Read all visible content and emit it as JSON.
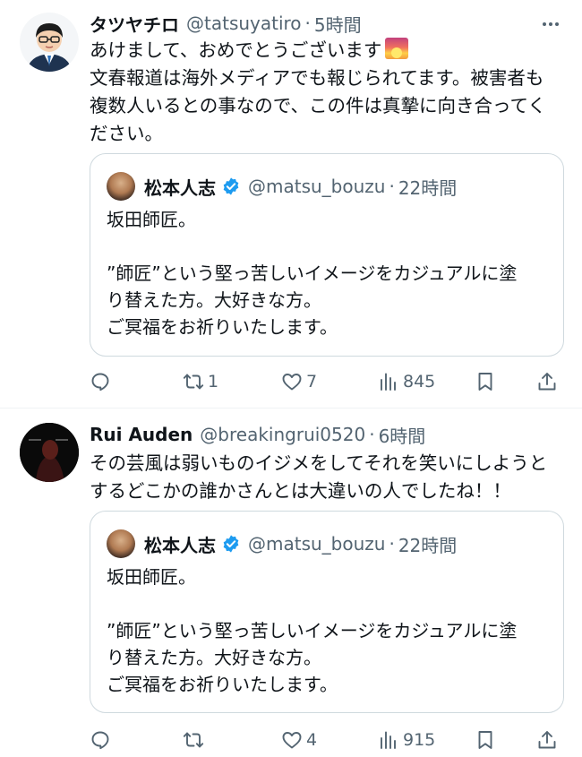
{
  "tweets": [
    {
      "author": {
        "name": "タツヤチロ",
        "handle": "@tatsuyatiro",
        "separator": "·",
        "time": "5時間"
      },
      "text_lines": [
        "あけまして、おめでとうございます",
        "文春報道は海外メディアでも報じられてます。被害者も",
        "複数人いるとの事なので、この件は真摯に向き合ってく",
        "ださい。"
      ],
      "emoji": "sunrise-emoji",
      "quote": {
        "author": {
          "name": "松本人志",
          "handle": "@matsu_bouzu",
          "separator": "·",
          "time": "22時間"
        },
        "lines": [
          "坂田師匠。",
          "”師匠”という堅っ苦しいイメージをカジュアルに塗",
          "り替えた方。大好きな方。",
          "ご冥福をお祈りいたします。"
        ]
      },
      "actions": {
        "reply": "",
        "retweet": "1",
        "like": "7",
        "views": "845"
      }
    },
    {
      "author": {
        "name": "Rui Auden",
        "handle": "@breakingrui0520",
        "separator": "·",
        "time": "6時間"
      },
      "text_lines": [
        "その芸風は弱いものイジメをしてそれを笑いにしようと",
        "するどこかの誰かさんとは大違いの人でしたね！！"
      ],
      "quote": {
        "author": {
          "name": "松本人志",
          "handle": "@matsu_bouzu",
          "separator": "·",
          "time": "22時間"
        },
        "lines": [
          "坂田師匠。",
          "”師匠”という堅っ苦しいイメージをカジュアルに塗",
          "り替えた方。大好きな方。",
          "ご冥福をお祈りいたします。"
        ]
      },
      "actions": {
        "reply": "",
        "retweet": "",
        "like": "4",
        "views": "915"
      }
    }
  ],
  "colors": {
    "text": "#0f1419",
    "secondary": "#536471",
    "border": "#cfd9de",
    "verified": "#1d9bf0"
  },
  "icons": [
    "more-icon",
    "reply-icon",
    "retweet-icon",
    "like-icon",
    "views-icon",
    "bookmark-icon",
    "share-icon",
    "verified-badge-icon"
  ]
}
